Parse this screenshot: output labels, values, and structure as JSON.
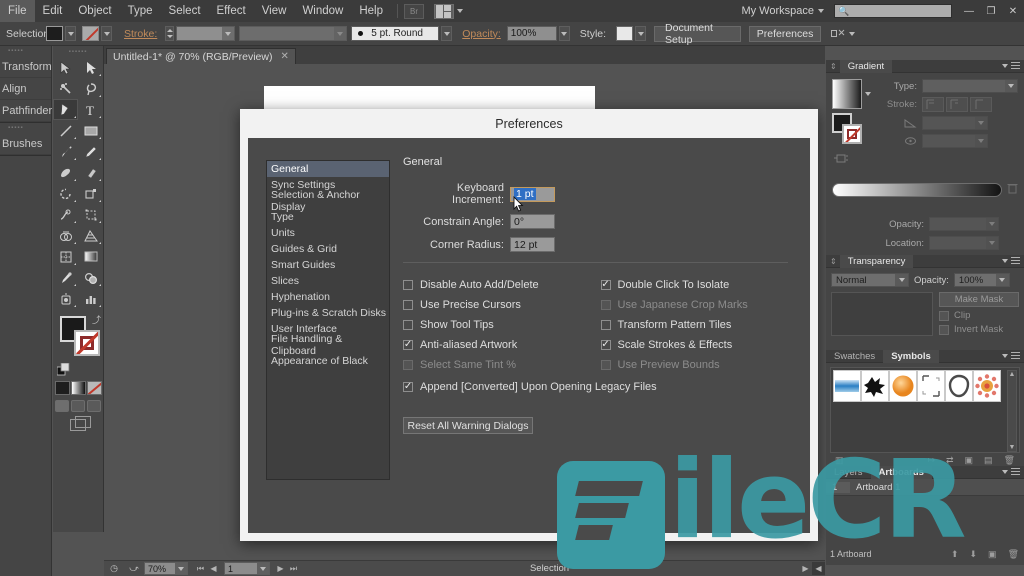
{
  "menubar": {
    "items": [
      "File",
      "Edit",
      "Object",
      "Type",
      "Select",
      "Effect",
      "View",
      "Window",
      "Help"
    ],
    "bridge_label": "Br",
    "workspace": "My Workspace",
    "search_placeholder": "",
    "minimize": "—",
    "restore": "❐",
    "close": "✕"
  },
  "controlbar": {
    "tool_label": "Selection",
    "stroke_label": "Stroke:",
    "brush_value": "5 pt. Round",
    "opacity_label": "Opacity:",
    "opacity_value": "100%",
    "style_label": "Style:",
    "document_setup": "Document Setup",
    "preferences": "Preferences"
  },
  "leftdock": {
    "groups": [
      {
        "items": [
          "Transform",
          "Align",
          "Pathfinder"
        ]
      },
      {
        "items": [
          "Brushes"
        ]
      }
    ]
  },
  "tools": {
    "rows": [
      [
        "selection-tool",
        "direct-selection-tool"
      ],
      [
        "magic-wand-tool",
        "lasso-tool"
      ],
      [
        "pen-tool",
        "type-tool"
      ],
      [
        "line-segment-tool",
        "rectangle-tool"
      ],
      [
        "paintbrush-tool",
        "pencil-tool"
      ],
      [
        "blob-brush-tool",
        "eraser-tool"
      ],
      [
        "rotate-tool",
        "scale-tool"
      ],
      [
        "width-tool",
        "free-transform-tool"
      ],
      [
        "shape-builder-tool",
        "perspective-grid-tool"
      ],
      [
        "mesh-tool",
        "gradient-tool"
      ],
      [
        "eyedropper-tool",
        "blend-tool"
      ],
      [
        "symbol-sprayer-tool",
        "column-graph-tool"
      ]
    ],
    "selected": "pen-tool"
  },
  "document": {
    "tab_label": "Untitled-1* @ 70% (RGB/Preview)",
    "tab_close": "✕"
  },
  "preferences": {
    "title": "Preferences",
    "categories": [
      "General",
      "Sync Settings",
      "Selection & Anchor Display",
      "Type",
      "Units",
      "Guides & Grid",
      "Smart Guides",
      "Slices",
      "Hyphenation",
      "Plug-ins & Scratch Disks",
      "User Interface",
      "File Handling & Clipboard",
      "Appearance of Black"
    ],
    "selected_category": "General",
    "section_title": "General",
    "fields": [
      {
        "label": "Keyboard Increment:",
        "value": "1 pt",
        "focused": true
      },
      {
        "label": "Constrain Angle:",
        "value": "0°",
        "focused": false
      },
      {
        "label": "Corner Radius:",
        "value": "12 pt",
        "focused": false
      }
    ],
    "checkboxes_left": [
      {
        "label": "Disable Auto Add/Delete",
        "checked": false,
        "disabled": false
      },
      {
        "label": "Use Precise Cursors",
        "checked": false,
        "disabled": false
      },
      {
        "label": "Show Tool Tips",
        "checked": false,
        "disabled": false
      },
      {
        "label": "Anti-aliased Artwork",
        "checked": true,
        "disabled": false
      },
      {
        "label": "Select Same Tint %",
        "checked": false,
        "disabled": true
      }
    ],
    "checkboxes_right": [
      {
        "label": "Double Click To Isolate",
        "checked": true,
        "disabled": false
      },
      {
        "label": "Use Japanese Crop Marks",
        "checked": false,
        "disabled": true
      },
      {
        "label": "Transform Pattern Tiles",
        "checked": false,
        "disabled": false
      },
      {
        "label": "Scale Strokes & Effects",
        "checked": true,
        "disabled": false
      },
      {
        "label": "Use Preview Bounds",
        "checked": false,
        "disabled": true
      }
    ],
    "checkbox_wide": {
      "label": "Append [Converted] Upon Opening Legacy Files",
      "checked": true
    },
    "reset_button": "Reset All Warning Dialogs"
  },
  "gradient_panel": {
    "title": "Gradient",
    "type_label": "Type:",
    "type_value": "",
    "stroke_label": "Stroke:",
    "angle_value": "",
    "aspect_value": "",
    "opacity_label": "Opacity:",
    "opacity_value": "",
    "location_label": "Location:",
    "location_value": ""
  },
  "transparency_panel": {
    "title": "Transparency",
    "blend_mode": "Normal",
    "opacity_label": "Opacity:",
    "opacity_value": "100%",
    "make_mask": "Make Mask",
    "clip": "Clip",
    "invert_mask": "Invert Mask"
  },
  "symbols_panel": {
    "tabs": [
      "Swatches",
      "Symbols"
    ],
    "active_tab": "Symbols",
    "symbols": [
      "gradient-swatch",
      "splatter-symbol",
      "orange-circle-symbol",
      "corner-bracket-symbol",
      "ring-symbol",
      "flower-symbol"
    ]
  },
  "layers_panel": {
    "tabs": [
      "Layers",
      "Artboards"
    ],
    "active_tab": "Artboards",
    "rows": [
      {
        "index": "1",
        "name": "Artboard 1"
      }
    ],
    "footer": "1 Artboard"
  },
  "statusbar": {
    "zoom": "70%",
    "page": "1",
    "status_text": "Selection"
  },
  "watermark": {
    "text": "ileCR",
    "color": "#3b9aa3"
  }
}
